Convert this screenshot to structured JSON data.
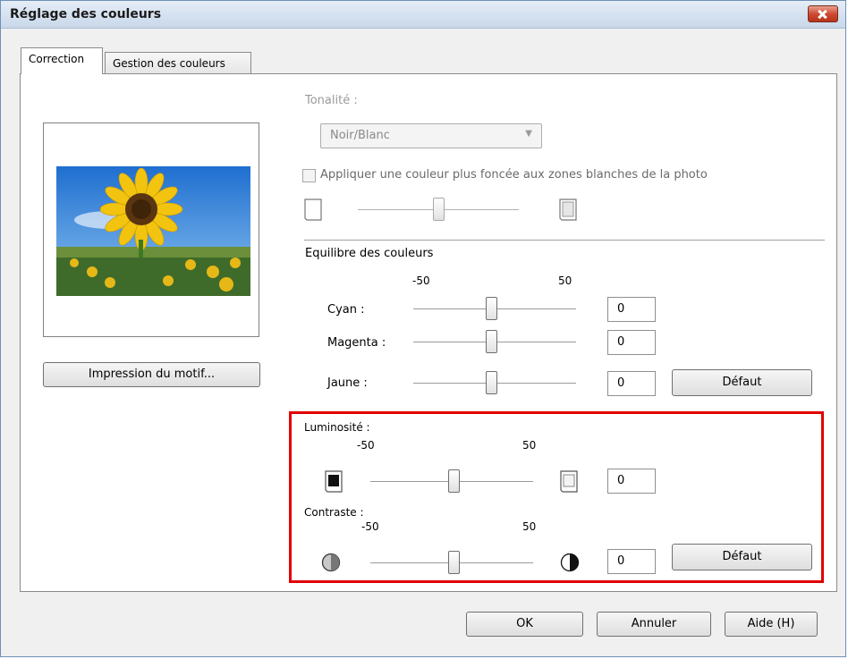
{
  "window": {
    "title": "Réglage des couleurs"
  },
  "tabs": [
    {
      "label": "Correction"
    },
    {
      "label": "Gestion des couleurs"
    }
  ],
  "preview": {
    "print_pattern_button": "Impression du motif..."
  },
  "tone": {
    "label": "Tonalité :",
    "combo_value": "Noir/Blanc",
    "darker_checkbox_label": "Appliquer une couleur plus foncée aux zones blanches de la photo"
  },
  "color_balance": {
    "heading": "Equilibre des couleurs",
    "min_label": "-50",
    "max_label": "50",
    "rows": [
      {
        "label": "Cyan :",
        "value": "0"
      },
      {
        "label": "Magenta :",
        "value": "0"
      },
      {
        "label": "Jaune :",
        "value": "0"
      }
    ],
    "default_button": "Défaut"
  },
  "brightness": {
    "label": "Luminosité :",
    "min_label": "-50",
    "max_label": "50",
    "value": "0"
  },
  "contrast": {
    "label": "Contraste :",
    "min_label": "-50",
    "max_label": "50",
    "value": "0",
    "default_button": "Défaut"
  },
  "footer": {
    "ok": "OK",
    "cancel": "Annuler",
    "help": "Aide (H)"
  },
  "colors": {
    "highlight_border": "#e00000",
    "close_button": "#cf4b33"
  }
}
